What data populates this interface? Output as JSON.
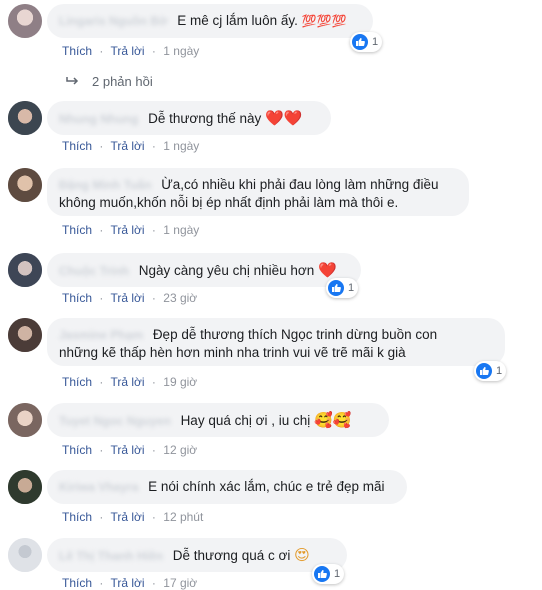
{
  "actions": {
    "like": "Thích",
    "reply": "Trả lời",
    "separator": "·"
  },
  "replies_link": {
    "label": "2 phản hồi"
  },
  "colors": {
    "like_blue": "#1877f2",
    "heart_red": "#e41e3f"
  },
  "comments": [
    {
      "text": "E mê cj lắm luôn ấy.",
      "emoji": "💯💯💯",
      "reactions": "1",
      "time": "1 ngày"
    },
    {
      "text": "Dễ thương thế này",
      "emoji": "❤️❤️",
      "reactions": "",
      "time": "1 ngày"
    },
    {
      "text": "Ừa,có nhiều khi phải đau lòng làm những điều",
      "text2": "không muốn,khốn nỗi bị ép nhất định phải làm mà thôi e.",
      "reactions": "",
      "time": "1 ngày"
    },
    {
      "text": "Ngày càng yêu chị nhiều hơn",
      "emoji": "❤️",
      "reactions": "1",
      "time": "23 giờ"
    },
    {
      "text": "Đẹp dễ thương thích Ngọc trinh dừng buồn con",
      "text2": "những kẽ thấp hèn hơn minh nha trinh vui vẽ trẽ mãi k già",
      "reactions": "1",
      "time": "19 giờ"
    },
    {
      "text": "Hay quá chị ơi , iu chị",
      "emoji": "🥰🥰",
      "reactions": "",
      "time": "12 giờ"
    },
    {
      "text": "E nói chính xác lắm, chúc e trẻ đẹp mãi",
      "reactions": "",
      "time": "12 phút"
    },
    {
      "text": "Dễ thương quá c ơi",
      "emoji": "😍",
      "reactions": "1",
      "time": "17 giờ"
    }
  ]
}
